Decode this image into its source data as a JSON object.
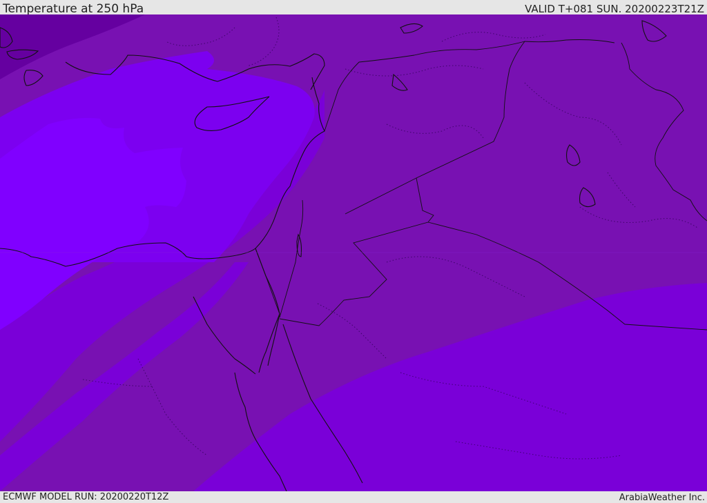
{
  "header": {
    "title": "Temperature at 250 hPa",
    "valid_time": "VALID T+081 SUN. 20200223T21Z"
  },
  "footer": {
    "model_run": "ECMWF MODEL RUN: 20200220T12Z",
    "credit": "ArabiaWeather Inc."
  },
  "map": {
    "field": "temperature",
    "level_hpa": 250,
    "colors": {
      "coldest": "#6500a0",
      "cold": "#6e00b6",
      "mid": "#7811b2",
      "warm": "#7a00d8",
      "warmer": "#7c00f0",
      "warmest": "#8000ff",
      "border": "#111111"
    }
  }
}
